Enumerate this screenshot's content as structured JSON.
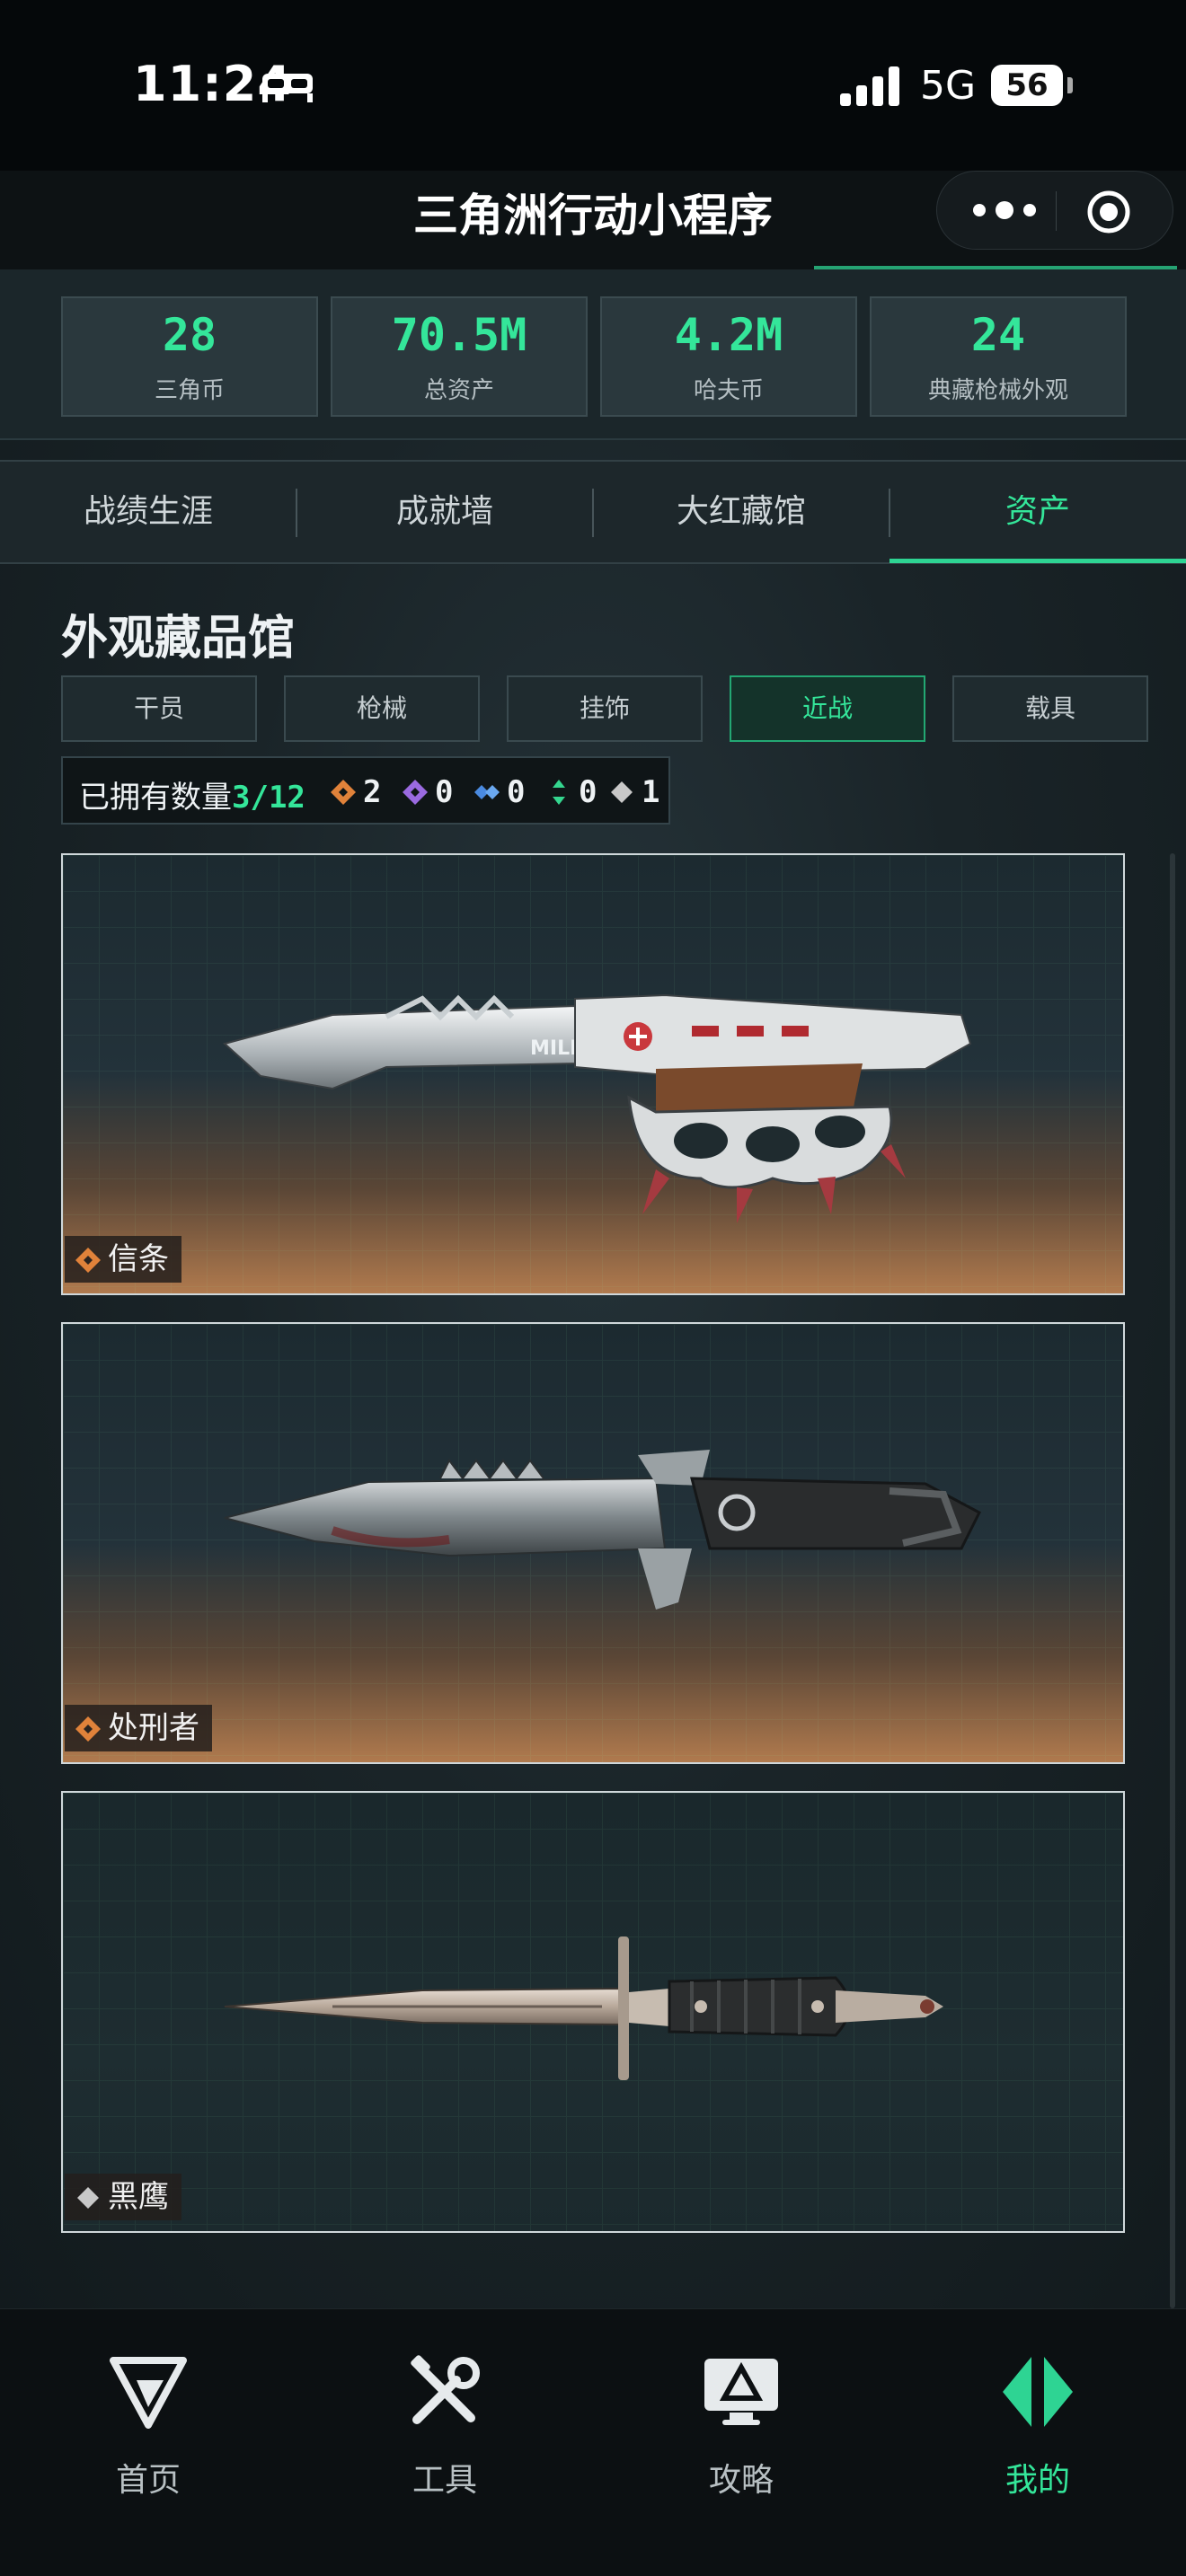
{
  "status_bar": {
    "time": "11:24",
    "network": "5G",
    "battery": "56",
    "icons": [
      "bed-icon",
      "signal-icon"
    ]
  },
  "titlebar": {
    "title": "三角洲行动小程序",
    "icons": [
      "more-dots-icon",
      "target-icon"
    ]
  },
  "stats": [
    {
      "value": "28",
      "label": "三角币"
    },
    {
      "value": "70.5M",
      "label": "总资产"
    },
    {
      "value": "4.2M",
      "label": "哈夫币"
    },
    {
      "value": "24",
      "label": "典藏枪械外观"
    }
  ],
  "tabs": [
    {
      "label": "战绩生涯",
      "active": false
    },
    {
      "label": "成就墙",
      "active": false
    },
    {
      "label": "大红藏馆",
      "active": false
    },
    {
      "label": "资产",
      "active": true
    }
  ],
  "section": {
    "title": "外观藏品馆"
  },
  "categories": [
    {
      "label": "干员",
      "active": false
    },
    {
      "label": "枪械",
      "active": false
    },
    {
      "label": "挂饰",
      "active": false
    },
    {
      "label": "近战",
      "active": true
    },
    {
      "label": "载具",
      "active": false
    }
  ],
  "owned": {
    "label": "已拥有数量",
    "count": "3/12",
    "rarities": [
      {
        "icon": "orange-diamond-icon",
        "color": "#e0823a",
        "value": "2"
      },
      {
        "icon": "purple-diamond-icon",
        "color": "#9a6ae0",
        "value": "0"
      },
      {
        "icon": "blue-diamond-icon",
        "color": "#4a8ae0",
        "value": "0"
      },
      {
        "icon": "green-arrows-icon",
        "color": "#34d68f",
        "value": "0"
      },
      {
        "icon": "gray-diamond-icon",
        "color": "#c8c8c8",
        "value": "1"
      }
    ]
  },
  "items": [
    {
      "name": "信条",
      "rarity": "orange",
      "rarity_color": "#e0823a",
      "blade_engraving": "MILLFIELD"
    },
    {
      "name": "处刑者",
      "rarity": "orange",
      "rarity_color": "#e0823a"
    },
    {
      "name": "黑鹰",
      "rarity": "gray",
      "rarity_color": "#c8c8c8"
    }
  ],
  "bottom_nav": [
    {
      "label": "首页",
      "icon": "delta-logo-icon",
      "active": false
    },
    {
      "label": "工具",
      "icon": "tools-icon",
      "active": false
    },
    {
      "label": "攻略",
      "icon": "monitor-guide-icon",
      "active": false
    },
    {
      "label": "我的",
      "icon": "profile-diamond-icon",
      "active": true
    }
  ],
  "colors": {
    "accent": "#34e69a",
    "background": "#1a2428"
  }
}
